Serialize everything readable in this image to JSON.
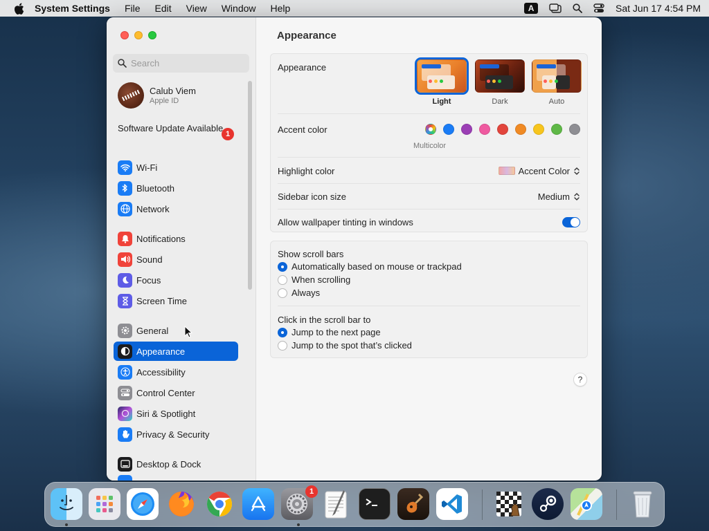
{
  "menubar": {
    "app_name": "System Settings",
    "items": [
      "File",
      "Edit",
      "View",
      "Window",
      "Help"
    ],
    "input_source": "A",
    "datetime": "Sat Jun 17  4:54 PM"
  },
  "sidebar": {
    "search_placeholder": "Search",
    "profile": {
      "name": "Calub Viem",
      "subtitle": "Apple ID"
    },
    "software_update": {
      "label": "Software Update Available",
      "badge": "1"
    },
    "items": [
      {
        "label": "Wi-Fi",
        "icon": "wifi-icon",
        "color": "#1a7cf5"
      },
      {
        "label": "Bluetooth",
        "icon": "bluetooth-icon",
        "color": "#1a7cf5"
      },
      {
        "label": "Network",
        "icon": "globe-icon",
        "color": "#1a7cf5"
      },
      {
        "label": "Notifications",
        "icon": "bell-icon",
        "color": "#f0433a"
      },
      {
        "label": "Sound",
        "icon": "speaker-icon",
        "color": "#f0433a"
      },
      {
        "label": "Focus",
        "icon": "moon-icon",
        "color": "#5e5ce6"
      },
      {
        "label": "Screen Time",
        "icon": "hourglass-icon",
        "color": "#5e5ce6"
      },
      {
        "label": "General",
        "icon": "gear-icon",
        "color": "#8e8e93"
      },
      {
        "label": "Appearance",
        "icon": "appearance-icon",
        "color": "#1c1c1e"
      },
      {
        "label": "Accessibility",
        "icon": "accessibility-icon",
        "color": "#1a7cf5"
      },
      {
        "label": "Control Center",
        "icon": "control-center-icon",
        "color": "#8e8e93"
      },
      {
        "label": "Siri & Spotlight",
        "icon": "siri-icon",
        "color": "#b44fd8"
      },
      {
        "label": "Privacy & Security",
        "icon": "hand-icon",
        "color": "#1a7cf5"
      },
      {
        "label": "Desktop & Dock",
        "icon": "dock-icon",
        "color": "#1c1c1e"
      }
    ]
  },
  "content": {
    "title": "Appearance",
    "appearance": {
      "label": "Appearance",
      "options": [
        "Light",
        "Dark",
        "Auto"
      ],
      "selected": "Light"
    },
    "accent": {
      "label": "Accent color",
      "selected_label": "Multicolor",
      "colors": [
        "multicolor",
        "#1a7cf5",
        "#9b3fb5",
        "#ef5aa0",
        "#e2453c",
        "#f08a24",
        "#f7c51e",
        "#5fb847",
        "#8e8e93"
      ]
    },
    "highlight": {
      "label": "Highlight color",
      "value": "Accent Color"
    },
    "sidebar_icon_size": {
      "label": "Sidebar icon size",
      "value": "Medium"
    },
    "wallpaper_tinting": {
      "label": "Allow wallpaper tinting in windows",
      "on": true
    },
    "scroll_bars": {
      "label": "Show scroll bars",
      "options": [
        "Automatically based on mouse or trackpad",
        "When scrolling",
        "Always"
      ],
      "selected": 0
    },
    "click_scroll": {
      "label": "Click in the scroll bar to",
      "options": [
        "Jump to the next page",
        "Jump to the spot that’s clicked"
      ],
      "selected": 0
    },
    "help": "?"
  },
  "dock": {
    "apps": [
      "finder-icon",
      "launchpad-icon",
      "safari-icon",
      "firefox-icon",
      "chrome-icon",
      "app-store-icon",
      "system-settings-icon",
      "textedit-icon",
      "terminal-icon",
      "garageband-icon",
      "vscode-icon",
      "chess-icon",
      "steam-icon",
      "maps-icon",
      "trash-icon"
    ],
    "settings_badge": "1"
  }
}
